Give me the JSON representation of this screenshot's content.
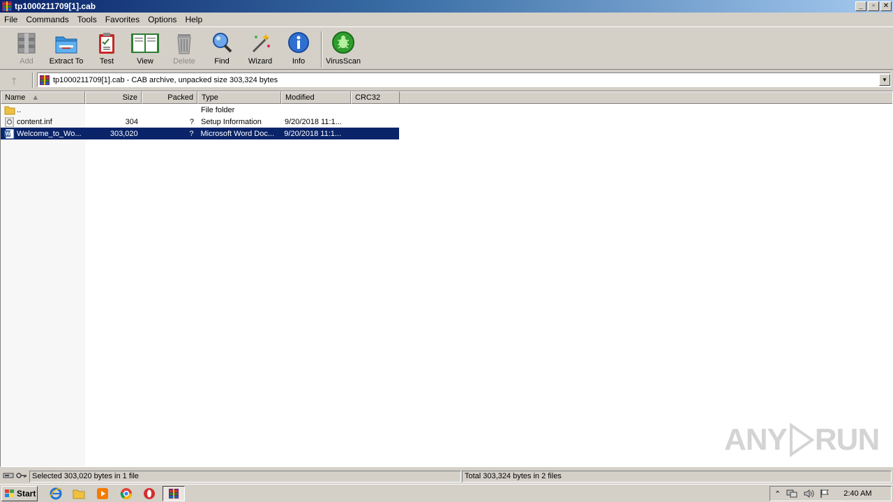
{
  "window": {
    "title": "tp1000211709[1].cab",
    "minimize": "_",
    "restore": "▫",
    "close": "✕"
  },
  "menu": [
    "File",
    "Commands",
    "Tools",
    "Favorites",
    "Options",
    "Help"
  ],
  "toolbar": {
    "add": "Add",
    "extract_to": "Extract To",
    "test": "Test",
    "view": "View",
    "delete": "Delete",
    "find": "Find",
    "wizard": "Wizard",
    "info": "Info",
    "virusscan": "VirusScan"
  },
  "address": {
    "text": "tp1000211709[1].cab - CAB archive, unpacked size 303,324 bytes"
  },
  "columns": {
    "name": "Name",
    "size": "Size",
    "packed": "Packed",
    "type": "Type",
    "modified": "Modified",
    "crc32": "CRC32"
  },
  "files": [
    {
      "name": "..",
      "size": "",
      "packed": "",
      "type": "File folder",
      "modified": "",
      "crc32": ""
    },
    {
      "name": "content.inf",
      "size": "304",
      "packed": "?",
      "type": "Setup Information",
      "modified": "9/20/2018 11:1...",
      "crc32": ""
    },
    {
      "name": "Welcome_to_Wo...",
      "size": "303,020",
      "packed": "?",
      "type": "Microsoft Word Doc...",
      "modified": "9/20/2018 11:1...",
      "crc32": ""
    }
  ],
  "status": {
    "selected": "Selected 303,020 bytes in 1 file",
    "total": "Total 303,324 bytes in 2 files"
  },
  "taskbar": {
    "start": "Start",
    "clock": "2:40 AM"
  },
  "watermark": {
    "left": "ANY",
    "right": "RUN"
  },
  "colors": {
    "selection": "#0a246a",
    "title_start": "#0a246a",
    "title_end": "#a6caf0"
  }
}
